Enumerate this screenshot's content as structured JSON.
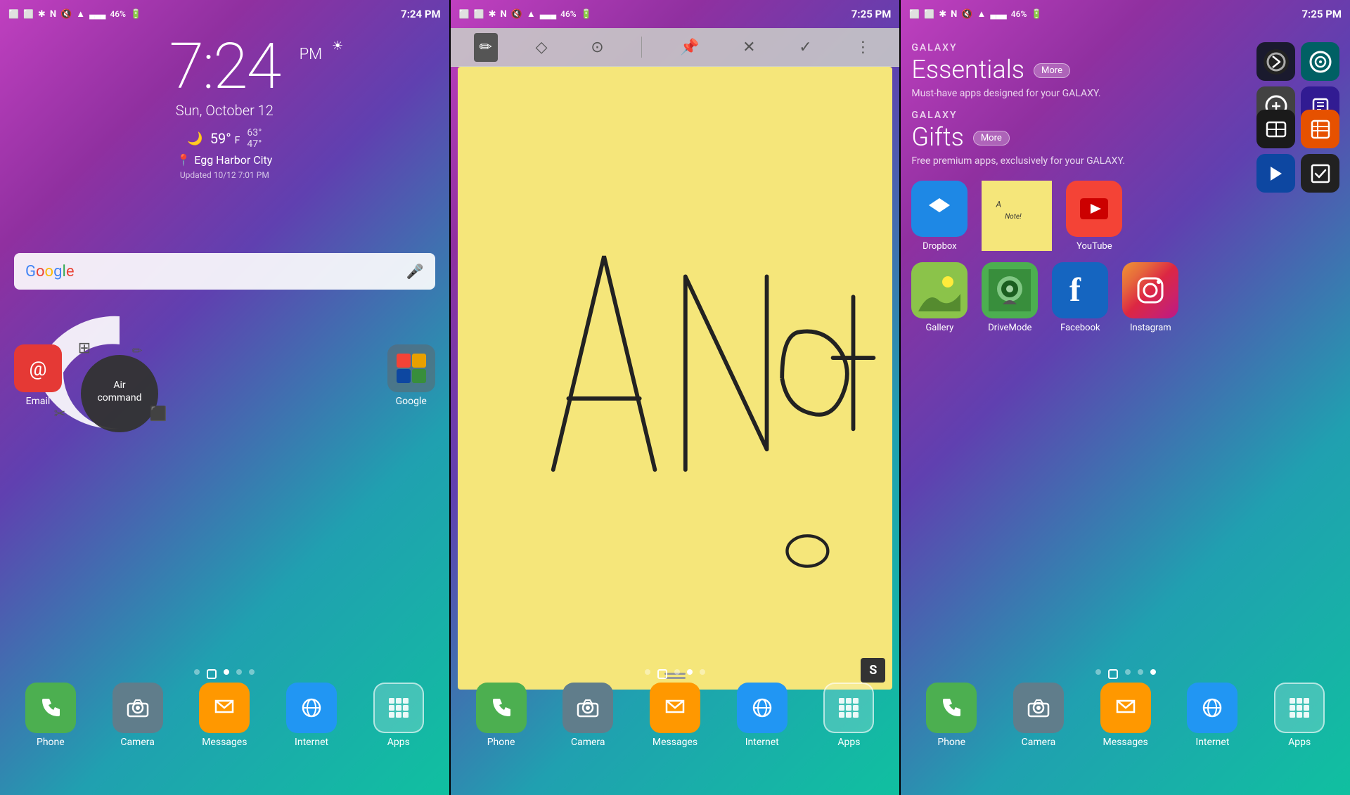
{
  "screens": [
    {
      "id": "screen1",
      "type": "home",
      "status_bar": {
        "time": "7:24 PM",
        "battery": "46%"
      },
      "clock": {
        "time": "7:24",
        "ampm": "PM",
        "date": "Sun, October 12"
      },
      "weather": {
        "temp": "59°",
        "high": "63°",
        "low": "47°",
        "unit": "F",
        "icon": "🌙"
      },
      "location": "Egg Harbor City",
      "updated": "Updated 10/12 7:01 PM",
      "google_bar": {
        "text": "Google",
        "mic_label": "mic"
      },
      "air_command": {
        "label": "Air command"
      },
      "dock": {
        "apps": [
          {
            "label": "Phone",
            "icon": "📞",
            "color": "#4caf50"
          },
          {
            "label": "Camera",
            "icon": "📷",
            "color": "#607d8b"
          },
          {
            "label": "Messages",
            "icon": "✉️",
            "color": "#ff9800"
          },
          {
            "label": "Internet",
            "icon": "🌐",
            "color": "#2196f3"
          },
          {
            "label": "Apps",
            "icon": "⋯",
            "color": "transparent"
          }
        ]
      },
      "home_icons": [
        {
          "label": "Email",
          "icon": "@",
          "color": "#e53935"
        },
        {
          "label": "Google",
          "icon": "G",
          "color": "#4285f4"
        }
      ]
    },
    {
      "id": "screen2",
      "type": "note",
      "status_bar": {
        "time": "7:25 PM",
        "battery": "46%"
      },
      "toolbar": {
        "icons": [
          "✏️",
          "◇",
          "⊙",
          "📌",
          "✕",
          "✓",
          "⋮"
        ]
      },
      "note": {
        "content": "A Note!",
        "handwritten": true
      },
      "dock": {
        "apps": [
          {
            "label": "Phone",
            "icon": "📞",
            "color": "#4caf50"
          },
          {
            "label": "Camera",
            "icon": "📷",
            "color": "#607d8b"
          },
          {
            "label": "Messages",
            "icon": "✉️",
            "color": "#ff9800"
          },
          {
            "label": "Internet",
            "icon": "🌐",
            "color": "#2196f3"
          },
          {
            "label": "Apps",
            "icon": "⋯",
            "color": "transparent"
          }
        ]
      }
    },
    {
      "id": "screen3",
      "type": "galaxy_store",
      "status_bar": {
        "time": "7:25 PM",
        "battery": "46%"
      },
      "essentials": {
        "section_label": "GALAXY",
        "title": "Essentials",
        "more_label": "More",
        "description": "Must-have apps designed for your GALAXY.",
        "apps": [
          {
            "icon": "🔒",
            "color": "#333"
          },
          {
            "icon": "📡",
            "color": "#009688"
          },
          {
            "icon": "⭕",
            "color": "#666"
          },
          {
            "icon": "📹",
            "color": "#333"
          }
        ]
      },
      "gifts": {
        "section_label": "GALAXY",
        "title": "Gifts",
        "more_label": "More",
        "description": "Free premium apps, exclusively for your GALAXY.",
        "apps": [
          {
            "icon": "📻",
            "color": "#222"
          },
          {
            "icon": "📊",
            "color": "#f57c00"
          },
          {
            "icon": "💙",
            "color": "#1565c0"
          },
          {
            "icon": "📖",
            "color": "#333"
          }
        ]
      },
      "featured": {
        "apps": [
          {
            "label": "Dropbox",
            "color": "#1e88e5"
          },
          {
            "label": "Note",
            "color": "#f5e67a",
            "is_note": true
          },
          {
            "label": "YouTube",
            "color": "#f44336"
          },
          {
            "label": "Gallery",
            "color": "#8bc34a"
          },
          {
            "label": "DriveMode",
            "color": "#4caf50"
          },
          {
            "label": "Facebook",
            "color": "#1565c0"
          },
          {
            "label": "Instagram",
            "color": "#c62828"
          }
        ]
      },
      "dock": {
        "apps": [
          {
            "label": "Phone",
            "icon": "📞",
            "color": "#4caf50"
          },
          {
            "label": "Camera",
            "icon": "📷",
            "color": "#607d8b"
          },
          {
            "label": "Messages",
            "icon": "✉️",
            "color": "#ff9800"
          },
          {
            "label": "Internet",
            "icon": "🌐",
            "color": "#2196f3"
          },
          {
            "label": "Apps",
            "icon": "⋯",
            "color": "transparent"
          }
        ]
      }
    }
  ],
  "icons": {
    "phone": "☎",
    "camera": "◉",
    "messages": "✉",
    "internet": "🌐",
    "apps": "⋯",
    "mic": "🎤",
    "pen": "✏",
    "eraser": "◇",
    "lasso": "⊙",
    "pin": "📌",
    "close": "✕",
    "check": "✓",
    "more_vert": "⋮",
    "bluetooth": "ᛒ",
    "nfc": "N",
    "mute": "🔇",
    "wifi": "📶",
    "signal": "📶",
    "battery": "🔋",
    "location": "📍",
    "moon": "🌙",
    "reload": "↺",
    "search": "🔍"
  }
}
